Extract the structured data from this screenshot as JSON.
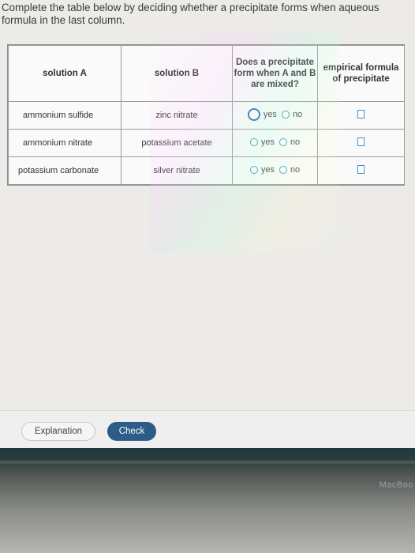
{
  "instructions": "Complete the table below by deciding whether a precipitate forms when aqueous formula in the last column.",
  "table": {
    "headers": {
      "solution_a": "solution A",
      "solution_b": "solution B",
      "does_precipitate": "Does a precipitate form when A and B are mixed?",
      "empirical_formula": "empirical formula of precipitate"
    },
    "options": {
      "yes": "yes",
      "no": "no"
    },
    "rows": [
      {
        "solution_a": "ammonium sulfide",
        "solution_b": "zinc nitrate",
        "selected": "none"
      },
      {
        "solution_a": "ammonium nitrate",
        "solution_b": "potassium acetate",
        "selected": "none"
      },
      {
        "solution_a": "potassium carbonate",
        "solution_b": "silver nitrate",
        "selected": "none"
      }
    ]
  },
  "buttons": {
    "explanation": "Explanation",
    "check": "Check"
  },
  "bezel_brand": "MacBoo",
  "colors": {
    "accent": "#2c5c87",
    "radio": "#3a94c7"
  }
}
